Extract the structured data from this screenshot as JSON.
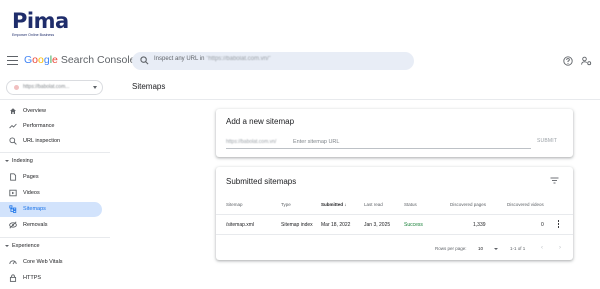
{
  "logo": {
    "text": "Pima",
    "tagline": "Empower Online Business"
  },
  "header": {
    "brand_google": "Google",
    "brand_product": "Search Console",
    "search_prefix": "Inspect any URL in",
    "search_property": "\"https://babolat.com.vn/\"",
    "property_url": "https://babolat.com..."
  },
  "page": {
    "title": "Sitemaps"
  },
  "nav": {
    "items": [
      {
        "label": "Overview",
        "icon": "home-icon"
      },
      {
        "label": "Performance",
        "icon": "trend-icon"
      },
      {
        "label": "URL inspection",
        "icon": "search-icon"
      }
    ],
    "section_indexing": "Indexing",
    "indexing_items": [
      {
        "label": "Pages",
        "icon": "page-icon"
      },
      {
        "label": "Videos",
        "icon": "video-icon"
      },
      {
        "label": "Sitemaps",
        "icon": "sitemap-icon",
        "active": true
      },
      {
        "label": "Removals",
        "icon": "removal-icon"
      }
    ],
    "section_experience": "Experience",
    "experience_items": [
      {
        "label": "Core Web Vitals",
        "icon": "gauge-icon"
      },
      {
        "label": "HTTPS",
        "icon": "lock-icon"
      }
    ]
  },
  "add_sitemap": {
    "title": "Add a new sitemap",
    "prefix": "https://babolat.com.vn/",
    "placeholder": "Enter sitemap URL",
    "submit_label": "SUBMIT"
  },
  "submitted": {
    "title": "Submitted sitemaps",
    "columns": [
      "Sitemap",
      "Type",
      "Submitted",
      "Last read",
      "Status",
      "Discovered pages",
      "Discovered videos"
    ],
    "sorted_column": "Submitted",
    "rows": [
      {
        "sitemap": "/sitemap.xml",
        "type": "Sitemap index",
        "submitted": "Mar 18, 2022",
        "last_read": "Jan 3, 2025",
        "status": "Success",
        "pages": "1,339",
        "videos": "0"
      }
    ],
    "rows_per_page_label": "Rows per page:",
    "rows_per_page": "10",
    "range": "1-1 of 1"
  },
  "colors": {
    "accent": "#1a73e8",
    "active_bg": "#d2e3fc",
    "success": "#188038",
    "search_bg": "#e8edf6"
  }
}
